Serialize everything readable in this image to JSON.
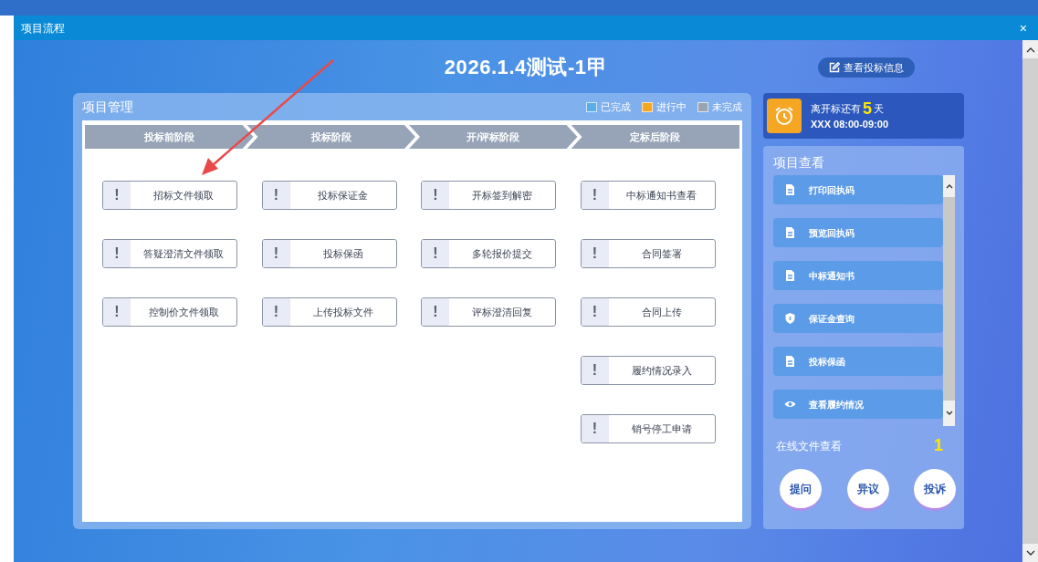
{
  "window": {
    "title": "项目流程",
    "close": "×"
  },
  "project_title": "2026.1.4测试-1甲",
  "view_bid_info_button": "查看投标信息",
  "management": {
    "title": "项目管理",
    "legend": [
      {
        "label": "已完成",
        "color": "#5aaee8"
      },
      {
        "label": "进行中",
        "color": "#f5a623"
      },
      {
        "label": "未完成",
        "color": "#9aa4b2"
      }
    ],
    "stages": [
      {
        "title": "投标前阶段",
        "tasks": [
          {
            "label": "招标文件领取",
            "done": false,
            "icon": "!"
          },
          {
            "label": "答疑澄清文件领取",
            "done": false,
            "icon": "!"
          },
          {
            "label": "控制价文件领取",
            "done": false,
            "icon": "!"
          }
        ]
      },
      {
        "title": "投标阶段",
        "tasks": [
          {
            "label": "投标保证金",
            "done": false,
            "icon": "!"
          },
          {
            "label": "投标保函",
            "done": false,
            "icon": "!"
          },
          {
            "label": "上传投标文件",
            "done": false,
            "icon": "!"
          }
        ]
      },
      {
        "title": "开/评标阶段",
        "tasks": [
          {
            "label": "开标签到解密",
            "done": false,
            "icon": "!"
          },
          {
            "label": "多轮报价提交",
            "done": false,
            "icon": "!"
          },
          {
            "label": "评标澄清回复",
            "done": false,
            "icon": "!"
          }
        ]
      },
      {
        "title": "定标后阶段",
        "tasks": [
          {
            "label": "中标通知书查看",
            "done": false,
            "icon": "!"
          },
          {
            "label": "合同签署",
            "done": false,
            "icon": "!"
          },
          {
            "label": "合同上传",
            "done": false,
            "icon": "!"
          },
          {
            "label": "履约情况录入",
            "done": false,
            "icon": "!"
          },
          {
            "label": "销号停工申请",
            "done": false,
            "icon": "!"
          }
        ]
      }
    ]
  },
  "countdown": {
    "prefix": "离开标还有",
    "days": "5",
    "suffix": "天",
    "time": "XXX 08:00-09:00"
  },
  "project_view": {
    "title": "项目查看",
    "items": [
      {
        "label": "打印回执码",
        "kind": "document"
      },
      {
        "label": "预览回执码",
        "kind": "document"
      },
      {
        "label": "中标通知书",
        "kind": "document"
      },
      {
        "label": "保证金查询",
        "kind": "shield"
      },
      {
        "label": "投标保函",
        "kind": "document"
      },
      {
        "label": "查看履约情况",
        "kind": "eye"
      }
    ],
    "online_files_label": "在线文件查看",
    "online_files_count": "1",
    "actions": [
      "提问",
      "异议",
      "投诉"
    ]
  }
}
